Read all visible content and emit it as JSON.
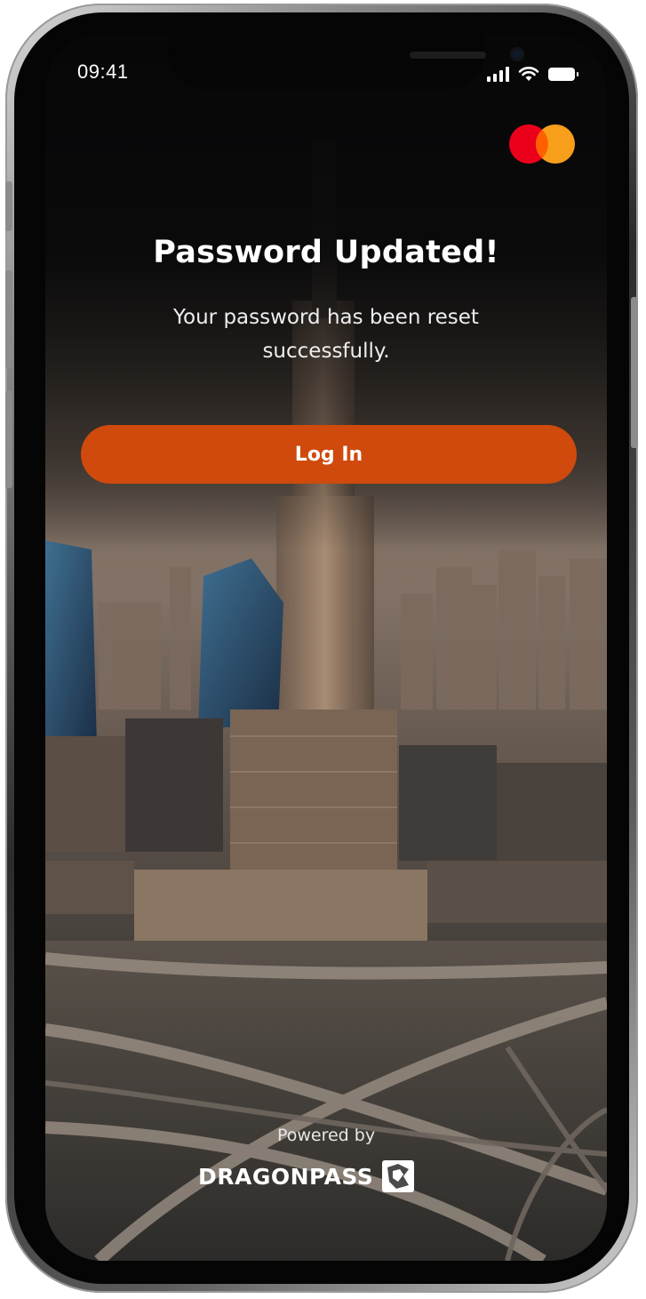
{
  "status_bar": {
    "time": "09:41",
    "signal_icon": "cellular-signal-icon",
    "wifi_icon": "wifi-icon",
    "battery_icon": "battery-icon"
  },
  "brand": {
    "logo_icon": "mastercard-logo",
    "colors": {
      "red": "#eb001b",
      "orange": "#f79e1b",
      "overlap": "#ff5f00"
    }
  },
  "main": {
    "title": "Password Updated!",
    "message": "Your password has been reset successfully.",
    "login_button_label": "Log In",
    "accent_color": "#cf4a0c"
  },
  "footer": {
    "powered_by": "Powered by",
    "partner_name": "DRAGONPASS",
    "partner_logo_icon": "dragonpass-mark-icon"
  }
}
